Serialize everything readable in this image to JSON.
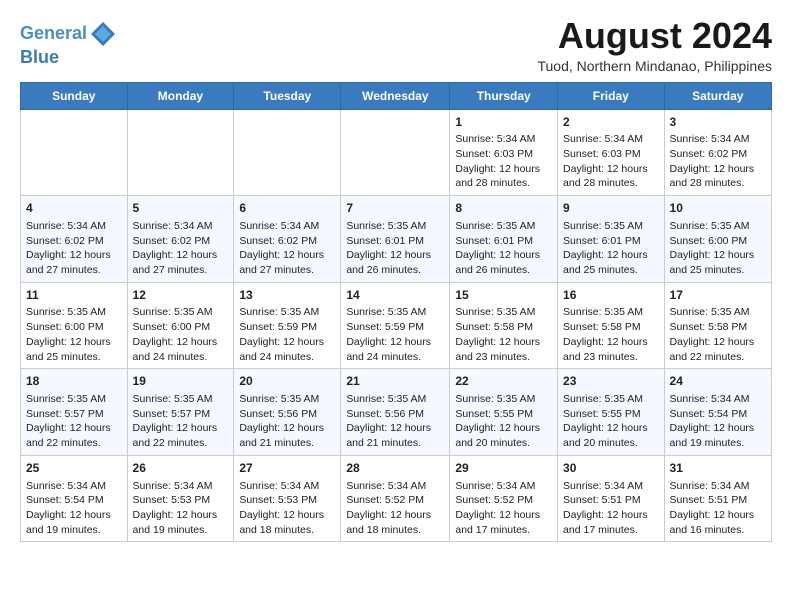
{
  "header": {
    "logo_line1": "General",
    "logo_line2": "Blue",
    "month_year": "August 2024",
    "location": "Tuod, Northern Mindanao, Philippines"
  },
  "days_of_week": [
    "Sunday",
    "Monday",
    "Tuesday",
    "Wednesday",
    "Thursday",
    "Friday",
    "Saturday"
  ],
  "weeks": [
    [
      {
        "day": "",
        "info": ""
      },
      {
        "day": "",
        "info": ""
      },
      {
        "day": "",
        "info": ""
      },
      {
        "day": "",
        "info": ""
      },
      {
        "day": "1",
        "info": "Sunrise: 5:34 AM\nSunset: 6:03 PM\nDaylight: 12 hours and 28 minutes."
      },
      {
        "day": "2",
        "info": "Sunrise: 5:34 AM\nSunset: 6:03 PM\nDaylight: 12 hours and 28 minutes."
      },
      {
        "day": "3",
        "info": "Sunrise: 5:34 AM\nSunset: 6:02 PM\nDaylight: 12 hours and 28 minutes."
      }
    ],
    [
      {
        "day": "4",
        "info": "Sunrise: 5:34 AM\nSunset: 6:02 PM\nDaylight: 12 hours and 27 minutes."
      },
      {
        "day": "5",
        "info": "Sunrise: 5:34 AM\nSunset: 6:02 PM\nDaylight: 12 hours and 27 minutes."
      },
      {
        "day": "6",
        "info": "Sunrise: 5:34 AM\nSunset: 6:02 PM\nDaylight: 12 hours and 27 minutes."
      },
      {
        "day": "7",
        "info": "Sunrise: 5:35 AM\nSunset: 6:01 PM\nDaylight: 12 hours and 26 minutes."
      },
      {
        "day": "8",
        "info": "Sunrise: 5:35 AM\nSunset: 6:01 PM\nDaylight: 12 hours and 26 minutes."
      },
      {
        "day": "9",
        "info": "Sunrise: 5:35 AM\nSunset: 6:01 PM\nDaylight: 12 hours and 25 minutes."
      },
      {
        "day": "10",
        "info": "Sunrise: 5:35 AM\nSunset: 6:00 PM\nDaylight: 12 hours and 25 minutes."
      }
    ],
    [
      {
        "day": "11",
        "info": "Sunrise: 5:35 AM\nSunset: 6:00 PM\nDaylight: 12 hours and 25 minutes."
      },
      {
        "day": "12",
        "info": "Sunrise: 5:35 AM\nSunset: 6:00 PM\nDaylight: 12 hours and 24 minutes."
      },
      {
        "day": "13",
        "info": "Sunrise: 5:35 AM\nSunset: 5:59 PM\nDaylight: 12 hours and 24 minutes."
      },
      {
        "day": "14",
        "info": "Sunrise: 5:35 AM\nSunset: 5:59 PM\nDaylight: 12 hours and 24 minutes."
      },
      {
        "day": "15",
        "info": "Sunrise: 5:35 AM\nSunset: 5:58 PM\nDaylight: 12 hours and 23 minutes."
      },
      {
        "day": "16",
        "info": "Sunrise: 5:35 AM\nSunset: 5:58 PM\nDaylight: 12 hours and 23 minutes."
      },
      {
        "day": "17",
        "info": "Sunrise: 5:35 AM\nSunset: 5:58 PM\nDaylight: 12 hours and 22 minutes."
      }
    ],
    [
      {
        "day": "18",
        "info": "Sunrise: 5:35 AM\nSunset: 5:57 PM\nDaylight: 12 hours and 22 minutes."
      },
      {
        "day": "19",
        "info": "Sunrise: 5:35 AM\nSunset: 5:57 PM\nDaylight: 12 hours and 22 minutes."
      },
      {
        "day": "20",
        "info": "Sunrise: 5:35 AM\nSunset: 5:56 PM\nDaylight: 12 hours and 21 minutes."
      },
      {
        "day": "21",
        "info": "Sunrise: 5:35 AM\nSunset: 5:56 PM\nDaylight: 12 hours and 21 minutes."
      },
      {
        "day": "22",
        "info": "Sunrise: 5:35 AM\nSunset: 5:55 PM\nDaylight: 12 hours and 20 minutes."
      },
      {
        "day": "23",
        "info": "Sunrise: 5:35 AM\nSunset: 5:55 PM\nDaylight: 12 hours and 20 minutes."
      },
      {
        "day": "24",
        "info": "Sunrise: 5:34 AM\nSunset: 5:54 PM\nDaylight: 12 hours and 19 minutes."
      }
    ],
    [
      {
        "day": "25",
        "info": "Sunrise: 5:34 AM\nSunset: 5:54 PM\nDaylight: 12 hours and 19 minutes."
      },
      {
        "day": "26",
        "info": "Sunrise: 5:34 AM\nSunset: 5:53 PM\nDaylight: 12 hours and 19 minutes."
      },
      {
        "day": "27",
        "info": "Sunrise: 5:34 AM\nSunset: 5:53 PM\nDaylight: 12 hours and 18 minutes."
      },
      {
        "day": "28",
        "info": "Sunrise: 5:34 AM\nSunset: 5:52 PM\nDaylight: 12 hours and 18 minutes."
      },
      {
        "day": "29",
        "info": "Sunrise: 5:34 AM\nSunset: 5:52 PM\nDaylight: 12 hours and 17 minutes."
      },
      {
        "day": "30",
        "info": "Sunrise: 5:34 AM\nSunset: 5:51 PM\nDaylight: 12 hours and 17 minutes."
      },
      {
        "day": "31",
        "info": "Sunrise: 5:34 AM\nSunset: 5:51 PM\nDaylight: 12 hours and 16 minutes."
      }
    ]
  ]
}
